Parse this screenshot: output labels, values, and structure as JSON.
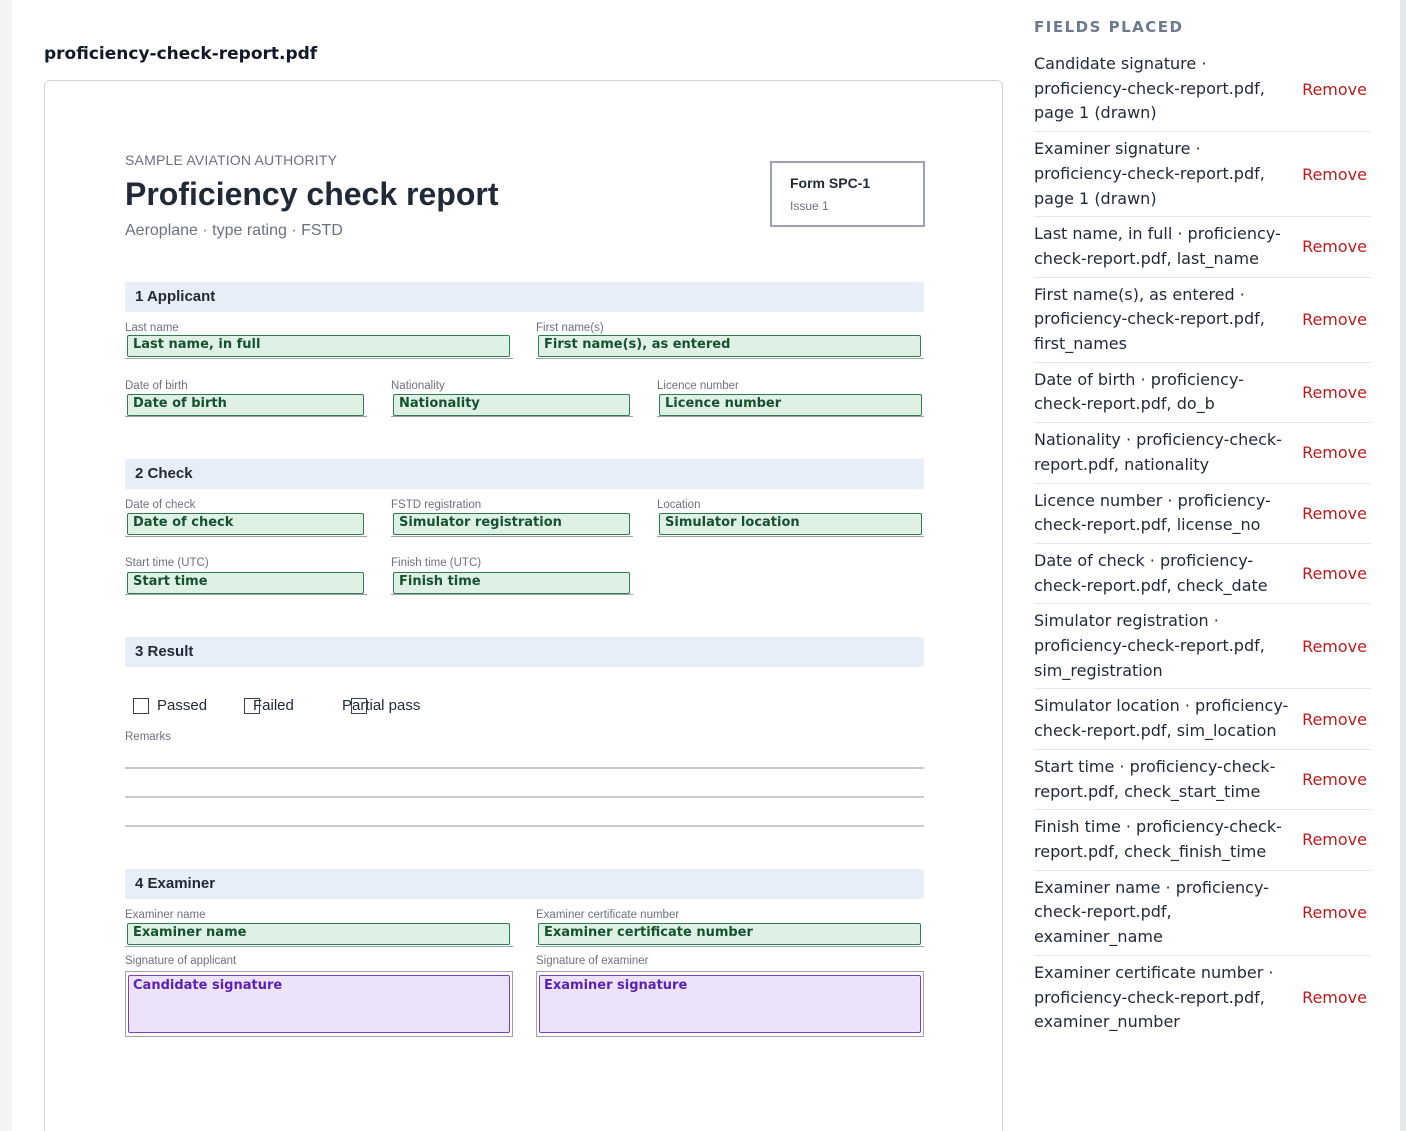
{
  "file_title": "proficiency-check-report.pdf",
  "document": {
    "authority": "SAMPLE AVIATION AUTHORITY",
    "title": "Proficiency check report",
    "subtitle": "Aeroplane · type rating · FSTD",
    "form_name": "Form SPC-1",
    "form_issue": "Issue 1",
    "sections": {
      "applicant": "1  Applicant",
      "check": "2  Check",
      "result": "3  Result",
      "examiner": "4  Examiner"
    },
    "labels": {
      "last_name": "Last name",
      "first_names": "First name(s)",
      "dob": "Date of birth",
      "nationality": "Nationality",
      "licence": "Licence number",
      "check_date": "Date of check",
      "fstd": "FSTD registration",
      "location": "Location",
      "start": "Start time (UTC)",
      "finish": "Finish time (UTC)",
      "remarks": "Remarks",
      "examiner_name": "Examiner name",
      "examiner_cert": "Examiner certificate number",
      "sig_applicant": "Signature of applicant",
      "sig_examiner": "Signature of examiner"
    },
    "fields": {
      "last_name": "Last name, in full",
      "first_names": "First name(s), as entered",
      "dob": "Date of birth",
      "nationality": "Nationality",
      "licence": "Licence number",
      "check_date": "Date of check",
      "sim_reg": "Simulator registration",
      "sim_loc": "Simulator location",
      "start": "Start time",
      "finish": "Finish time",
      "examiner_name": "Examiner name",
      "examiner_cert": "Examiner certificate number",
      "cand_sig": "Candidate signature",
      "exam_sig": "Examiner signature"
    },
    "result_options": {
      "passed": "Passed",
      "failed": "Failed",
      "partial": "Partial pass"
    }
  },
  "sidebar": {
    "heading": "FIELDS PLACED",
    "remove_label": "Remove",
    "items": [
      "Candidate signature · proficiency-check-report.pdf, page 1 (drawn)",
      "Examiner signature · proficiency-check-report.pdf, page 1 (drawn)",
      "Last name, in full · proficiency-check-report.pdf, last_name",
      "First name(s), as entered · proficiency-check-report.pdf, first_names",
      "Date of birth · proficiency-check-report.pdf, do_b",
      "Nationality · proficiency-check-report.pdf, nationality",
      "Licence number · proficiency-check-report.pdf, license_no",
      "Date of check · proficiency-check-report.pdf, check_date",
      "Simulator registration · proficiency-check-report.pdf, sim_registration",
      "Simulator location · proficiency-check-report.pdf, sim_location",
      "Start time · proficiency-check-report.pdf, check_start_time",
      "Finish time · proficiency-check-report.pdf, check_finish_time",
      "Examiner name · proficiency-check-report.pdf, examiner_name",
      "Examiner certificate number · proficiency-check-report.pdf, examiner_number"
    ]
  }
}
